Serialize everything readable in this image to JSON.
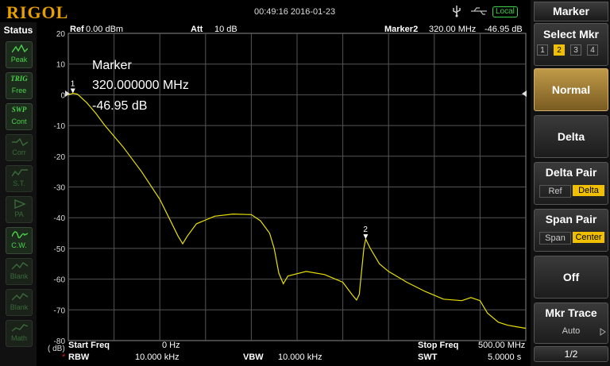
{
  "header": {
    "logo": "RIGOL",
    "datetime": "00:49:16 2016-01-23",
    "local_label": "Local"
  },
  "status": {
    "title": "Status",
    "buttons": [
      {
        "name": "peak",
        "icon": "peak-icon",
        "label": "Peak",
        "active": true
      },
      {
        "name": "trig",
        "top": "TRIG",
        "label": "Free",
        "active": true
      },
      {
        "name": "swp",
        "top": "SWP",
        "label": "Cont",
        "active": true
      },
      {
        "name": "corr",
        "icon": "corr-icon",
        "label": "Corr",
        "active": false
      },
      {
        "name": "st",
        "icon": "st-icon",
        "label": "S.T.",
        "active": false
      },
      {
        "name": "pa",
        "icon": "pa-icon",
        "label": "PA",
        "active": false
      },
      {
        "name": "cw",
        "icon": "cw-icon",
        "label": "C.W.",
        "active": true
      },
      {
        "name": "blank1",
        "icon": "blank-icon",
        "label": "Blank",
        "active": false
      },
      {
        "name": "blank2",
        "icon": "blank-icon",
        "label": "Blank",
        "active": false
      },
      {
        "name": "math",
        "icon": "math-icon",
        "label": "Math",
        "active": false
      }
    ]
  },
  "display": {
    "ref_label": "Ref",
    "ref_value": "0.00 dBm",
    "att_label": "Att",
    "att_value": "10 dB",
    "marker2_label": "Marker2",
    "marker2_freq": "320.00 MHz",
    "marker2_level": "-46.95 dB",
    "marker_box": {
      "title": "Marker",
      "freq": "320.000000 MHz",
      "level": "-46.95 dB"
    },
    "scale_unit": "( dB)",
    "start_label": "Start Freq",
    "start_value": "0 Hz",
    "stop_label": "Stop Freq",
    "stop_value": "500.00 MHz",
    "rbw_label": "RBW",
    "rbw_value": "10.000 kHz",
    "vbw_label": "VBW",
    "vbw_value": "10.000 kHz",
    "swt_label": "SWT",
    "swt_value": "5.0000 s",
    "y_ticks": [
      "20",
      "10",
      "0",
      "-10",
      "-20",
      "-30",
      "-40",
      "-50",
      "-60",
      "-70",
      "-80"
    ],
    "marker_labels": [
      "1",
      "2"
    ],
    "trace_color": "#e8e000"
  },
  "trace": {
    "x_unit": "MHz",
    "y_unit": "dB",
    "points": [
      [
        0,
        0
      ],
      [
        5,
        0.5
      ],
      [
        10,
        0.2
      ],
      [
        20,
        -2.5
      ],
      [
        30,
        -6
      ],
      [
        40,
        -10
      ],
      [
        60,
        -17
      ],
      [
        80,
        -25
      ],
      [
        100,
        -34
      ],
      [
        110,
        -40
      ],
      [
        120,
        -46
      ],
      [
        125,
        -48.5
      ],
      [
        130,
        -46
      ],
      [
        140,
        -42
      ],
      [
        160,
        -39.5
      ],
      [
        180,
        -38.8
      ],
      [
        200,
        -39
      ],
      [
        210,
        -41
      ],
      [
        220,
        -45
      ],
      [
        225,
        -50
      ],
      [
        230,
        -58
      ],
      [
        235,
        -61.5
      ],
      [
        240,
        -59
      ],
      [
        260,
        -57.5
      ],
      [
        280,
        -58.5
      ],
      [
        300,
        -61
      ],
      [
        310,
        -65
      ],
      [
        315,
        -66.8
      ],
      [
        318,
        -65
      ],
      [
        321,
        -56
      ],
      [
        323,
        -50
      ],
      [
        325,
        -46.95
      ],
      [
        330,
        -50
      ],
      [
        340,
        -55
      ],
      [
        350,
        -57.5
      ],
      [
        370,
        -61
      ],
      [
        390,
        -64
      ],
      [
        410,
        -66.5
      ],
      [
        430,
        -67
      ],
      [
        440,
        -66
      ],
      [
        450,
        -67
      ],
      [
        458,
        -71
      ],
      [
        470,
        -74
      ],
      [
        480,
        -75
      ],
      [
        490,
        -75.5
      ],
      [
        500,
        -76
      ]
    ],
    "marker1": [
      5,
      0.5
    ],
    "marker2": [
      325,
      -46.95
    ]
  },
  "menu": {
    "title": "Marker",
    "select_mkr_label": "Select Mkr",
    "mkr_numbers": [
      "1",
      "2",
      "3",
      "4"
    ],
    "mkr_selected": 1,
    "normal_label": "Normal",
    "delta_label": "Delta",
    "delta_pair_label": "Delta Pair",
    "delta_pair_opts": [
      "Ref",
      "Delta"
    ],
    "span_pair_label": "Span Pair",
    "span_pair_opts": [
      "Span",
      "Center"
    ],
    "off_label": "Off",
    "mkr_trace_label": "Mkr Trace",
    "mkr_trace_value": "Auto",
    "page_label": "1/2"
  }
}
